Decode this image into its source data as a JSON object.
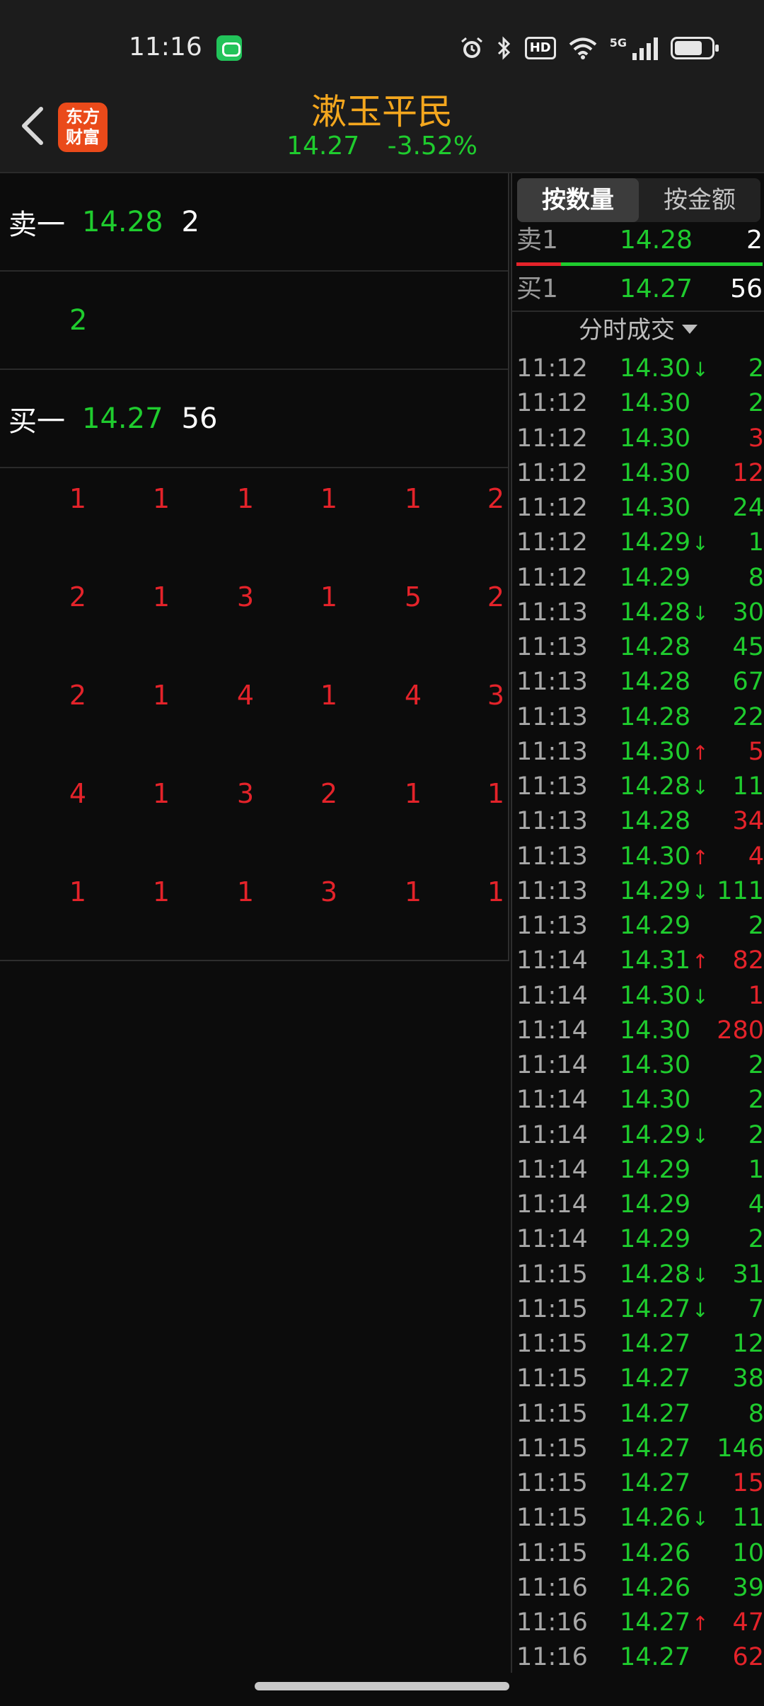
{
  "status_bar": {
    "time": "11:16",
    "icons": [
      "chat-app-icon",
      "alarm-icon",
      "bluetooth-icon",
      "hd-icon",
      "wifi-icon",
      "5g-signal-icon",
      "battery-icon"
    ],
    "hd_label": "HD",
    "network_label": "5G"
  },
  "header": {
    "logo_text_line1": "东方",
    "logo_text_line2": "财富",
    "stock_name": "漱玉平民",
    "price": "14.27",
    "change_pct": "-3.52%"
  },
  "order_book": {
    "sell1": {
      "label": "卖一",
      "price": "14.28",
      "volume": "2"
    },
    "middle_volume": "2",
    "buy1": {
      "label": "买一",
      "price": "14.27",
      "volume": "56"
    },
    "queue": [
      [
        "1",
        "1",
        "1",
        "1",
        "1",
        "2"
      ],
      [
        "2",
        "1",
        "3",
        "1",
        "5",
        "2"
      ],
      [
        "2",
        "1",
        "4",
        "1",
        "4",
        "3"
      ],
      [
        "4",
        "1",
        "3",
        "2",
        "1",
        "1"
      ],
      [
        "1",
        "1",
        "1",
        "3",
        "1",
        "1"
      ]
    ]
  },
  "right_panel": {
    "tabs": [
      {
        "label": "按数量",
        "active": true
      },
      {
        "label": "按金额",
        "active": false
      }
    ],
    "sell1": {
      "label": "卖1",
      "price": "14.28",
      "volume": "2"
    },
    "buy1": {
      "label": "买1",
      "price": "14.27",
      "volume": "56"
    },
    "sell_ratio": 0.18,
    "section_title": "分时成交",
    "colors": {
      "up": "#e4232a",
      "down": "#1fcc2e",
      "accent": "#f4a71e"
    },
    "trades": [
      {
        "time": "11:12",
        "price": "14.30",
        "arrow": "↓",
        "volume": "2",
        "side": "green"
      },
      {
        "time": "11:12",
        "price": "14.30",
        "arrow": "",
        "volume": "2",
        "side": "green"
      },
      {
        "time": "11:12",
        "price": "14.30",
        "arrow": "",
        "volume": "3",
        "side": "red"
      },
      {
        "time": "11:12",
        "price": "14.30",
        "arrow": "",
        "volume": "12",
        "side": "red"
      },
      {
        "time": "11:12",
        "price": "14.30",
        "arrow": "",
        "volume": "24",
        "side": "green"
      },
      {
        "time": "11:12",
        "price": "14.29",
        "arrow": "↓",
        "volume": "1",
        "side": "green"
      },
      {
        "time": "11:12",
        "price": "14.29",
        "arrow": "",
        "volume": "8",
        "side": "green"
      },
      {
        "time": "11:13",
        "price": "14.28",
        "arrow": "↓",
        "volume": "30",
        "side": "green"
      },
      {
        "time": "11:13",
        "price": "14.28",
        "arrow": "",
        "volume": "45",
        "side": "green"
      },
      {
        "time": "11:13",
        "price": "14.28",
        "arrow": "",
        "volume": "67",
        "side": "green"
      },
      {
        "time": "11:13",
        "price": "14.28",
        "arrow": "",
        "volume": "22",
        "side": "green"
      },
      {
        "time": "11:13",
        "price": "14.30",
        "arrow": "↑",
        "volume": "5",
        "side": "red"
      },
      {
        "time": "11:13",
        "price": "14.28",
        "arrow": "↓",
        "volume": "11",
        "side": "green"
      },
      {
        "time": "11:13",
        "price": "14.28",
        "arrow": "",
        "volume": "34",
        "side": "red"
      },
      {
        "time": "11:13",
        "price": "14.30",
        "arrow": "↑",
        "volume": "4",
        "side": "red"
      },
      {
        "time": "11:13",
        "price": "14.29",
        "arrow": "↓",
        "volume": "111",
        "side": "green"
      },
      {
        "time": "11:13",
        "price": "14.29",
        "arrow": "",
        "volume": "2",
        "side": "green"
      },
      {
        "time": "11:14",
        "price": "14.31",
        "arrow": "↑",
        "volume": "82",
        "side": "red"
      },
      {
        "time": "11:14",
        "price": "14.30",
        "arrow": "↓",
        "volume": "1",
        "side": "red"
      },
      {
        "time": "11:14",
        "price": "14.30",
        "arrow": "",
        "volume": "280",
        "side": "red"
      },
      {
        "time": "11:14",
        "price": "14.30",
        "arrow": "",
        "volume": "2",
        "side": "green"
      },
      {
        "time": "11:14",
        "price": "14.30",
        "arrow": "",
        "volume": "2",
        "side": "green"
      },
      {
        "time": "11:14",
        "price": "14.29",
        "arrow": "↓",
        "volume": "2",
        "side": "green"
      },
      {
        "time": "11:14",
        "price": "14.29",
        "arrow": "",
        "volume": "1",
        "side": "green"
      },
      {
        "time": "11:14",
        "price": "14.29",
        "arrow": "",
        "volume": "4",
        "side": "green"
      },
      {
        "time": "11:14",
        "price": "14.29",
        "arrow": "",
        "volume": "2",
        "side": "green"
      },
      {
        "time": "11:15",
        "price": "14.28",
        "arrow": "↓",
        "volume": "31",
        "side": "green"
      },
      {
        "time": "11:15",
        "price": "14.27",
        "arrow": "↓",
        "volume": "7",
        "side": "green"
      },
      {
        "time": "11:15",
        "price": "14.27",
        "arrow": "",
        "volume": "12",
        "side": "green"
      },
      {
        "time": "11:15",
        "price": "14.27",
        "arrow": "",
        "volume": "38",
        "side": "green"
      },
      {
        "time": "11:15",
        "price": "14.27",
        "arrow": "",
        "volume": "8",
        "side": "green"
      },
      {
        "time": "11:15",
        "price": "14.27",
        "arrow": "",
        "volume": "146",
        "side": "green"
      },
      {
        "time": "11:15",
        "price": "14.27",
        "arrow": "",
        "volume": "15",
        "side": "red"
      },
      {
        "time": "11:15",
        "price": "14.26",
        "arrow": "↓",
        "volume": "11",
        "side": "green"
      },
      {
        "time": "11:15",
        "price": "14.26",
        "arrow": "",
        "volume": "10",
        "side": "green"
      },
      {
        "time": "11:16",
        "price": "14.26",
        "arrow": "",
        "volume": "39",
        "side": "green"
      },
      {
        "time": "11:16",
        "price": "14.27",
        "arrow": "↑",
        "volume": "47",
        "side": "red"
      },
      {
        "time": "11:16",
        "price": "14.27",
        "arrow": "",
        "volume": "62",
        "side": "red"
      }
    ]
  }
}
